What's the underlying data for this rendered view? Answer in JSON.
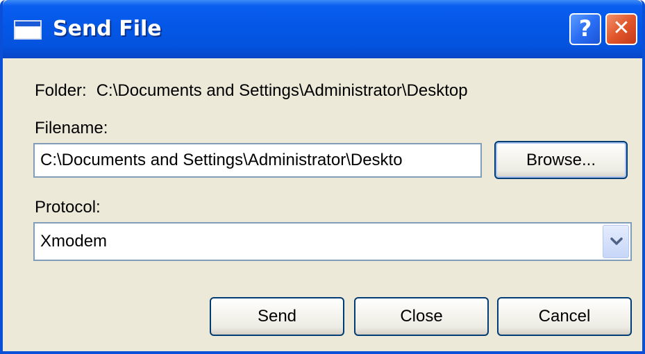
{
  "window": {
    "title": "Send File",
    "help_glyph": "?",
    "close_glyph": "✕",
    "title_icon": "window-app-icon"
  },
  "folder": {
    "label": "Folder:",
    "path": "C:\\Documents and Settings\\Administrator\\Desktop"
  },
  "filename": {
    "label": "Filename:",
    "value": "C:\\Documents and Settings\\Administrator\\Deskto"
  },
  "buttons": {
    "browse": "Browse...",
    "send": "Send",
    "close": "Close",
    "cancel": "Cancel"
  },
  "protocol": {
    "label": "Protocol:",
    "selected": "Xmodem"
  },
  "colors": {
    "titlebar": "#0457e6",
    "dialog_bg": "#ece9d8",
    "close_button": "#e2562b",
    "help_button": "#2a6ef5",
    "field_border": "#7f9db9"
  }
}
